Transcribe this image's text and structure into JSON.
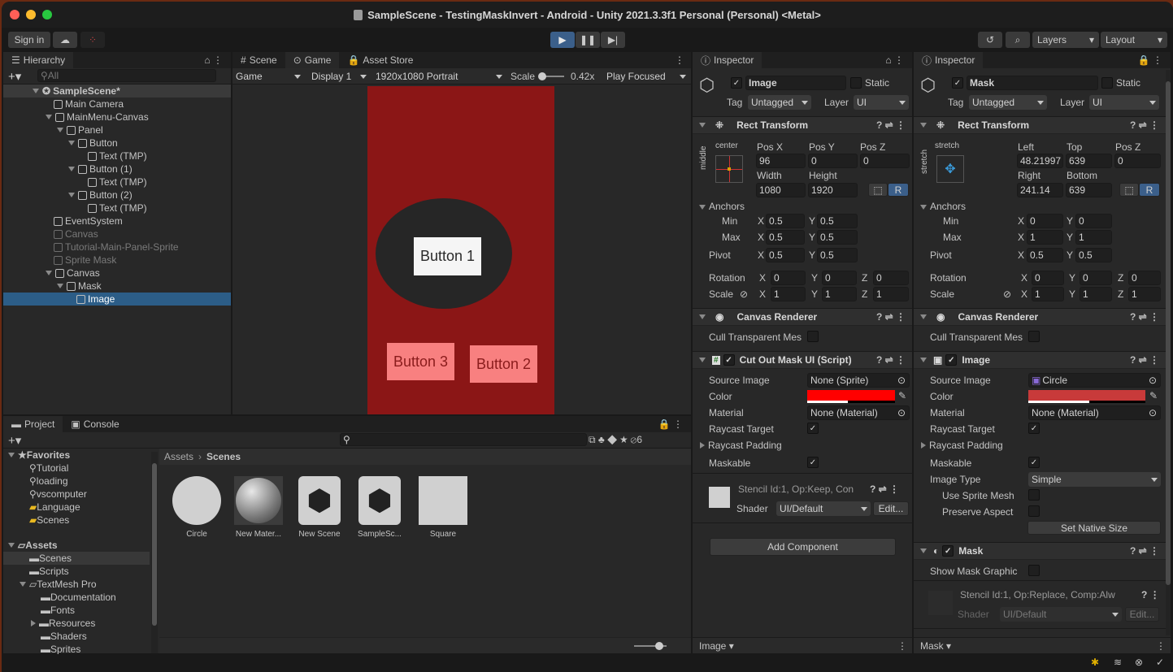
{
  "window": {
    "title": "SampleScene - TestingMaskInvert - Android - Unity 2021.3.3f1 Personal (Personal) <Metal>"
  },
  "toolbar": {
    "sign_in": "Sign in",
    "layers": "Layers",
    "layout": "Layout"
  },
  "hierarchy": {
    "tab": "Hierarchy",
    "search_placeholder": "All",
    "items": [
      {
        "label": "SampleScene*"
      },
      {
        "label": "Main Camera"
      },
      {
        "label": "MainMenu-Canvas"
      },
      {
        "label": "Panel"
      },
      {
        "label": "Button"
      },
      {
        "label": "Text (TMP)"
      },
      {
        "label": "Button (1)"
      },
      {
        "label": "Text (TMP)"
      },
      {
        "label": "Button (2)"
      },
      {
        "label": "Text (TMP)"
      },
      {
        "label": "EventSystem"
      },
      {
        "label": "Canvas"
      },
      {
        "label": "Tutorial-Main-Panel-Sprite"
      },
      {
        "label": "Sprite Mask"
      },
      {
        "label": "Canvas"
      },
      {
        "label": "Mask"
      },
      {
        "label": "Image"
      }
    ]
  },
  "game_view": {
    "tabs": [
      "Scene",
      "Game",
      "Asset Store"
    ],
    "mode": "Game",
    "display": "Display 1",
    "resolution": "1920x1080 Portrait",
    "scale_label": "Scale",
    "scale_value": "0.42x",
    "play_mode": "Play Focused",
    "buttons": [
      "Button 1",
      "Button 3",
      "Button 2"
    ],
    "colors": {
      "background": "#8b1616",
      "circle": "#262626",
      "button1": "#f5f5f5",
      "button_pink": "#f88080"
    }
  },
  "project": {
    "tabs": [
      "Project",
      "Console"
    ],
    "hidden_count": "6",
    "favorites_label": "Favorites",
    "favorites": [
      "Tutorial",
      "loading",
      "vscomputer",
      "Language",
      "Scenes"
    ],
    "assets_label": "Assets",
    "folders": [
      "Scenes",
      "Scripts",
      "TextMesh Pro",
      "Documentation",
      "Fonts",
      "Resources",
      "Shaders",
      "Sprites"
    ],
    "breadcrumb": [
      "Assets",
      "Scenes"
    ],
    "files": [
      "Circle",
      "New Mater...",
      "New Scene",
      "SampleSc...",
      "Square"
    ]
  },
  "inspector_left": {
    "tab": "Inspector",
    "name": "Image",
    "static": "Static",
    "tag_label": "Tag",
    "tag": "Untagged",
    "layer_label": "Layer",
    "layer": "UI",
    "rect": {
      "title": "Rect Transform",
      "anchor_h": "center",
      "anchor_v": "middle",
      "labels": [
        "Pos X",
        "Pos Y",
        "Pos Z",
        "Width",
        "Height"
      ],
      "values": [
        "96",
        "0",
        "0",
        "1080",
        "1920"
      ],
      "anchors": "Anchors",
      "min": "Min",
      "max": "Max",
      "pivot": "Pivot",
      "min_x": "0.5",
      "min_y": "0.5",
      "max_x": "0.5",
      "max_y": "0.5",
      "pivot_x": "0.5",
      "pivot_y": "0.5",
      "rotation": "Rotation",
      "scale": "Scale",
      "rot": [
        "0",
        "0",
        "0"
      ],
      "scl": [
        "1",
        "1",
        "1"
      ]
    },
    "canvas_renderer": {
      "title": "Canvas Renderer",
      "cull": "Cull Transparent Mes"
    },
    "script": {
      "title": "Cut Out Mask UI (Script)",
      "source_image": "Source Image",
      "source_value": "None (Sprite)",
      "color": "Color",
      "color_value": "#ff0000",
      "material": "Material",
      "material_value": "None (Material)",
      "raycast": "Raycast Target",
      "padding": "Raycast Padding",
      "maskable": "Maskable"
    },
    "material_preview": {
      "stencil": "Stencil Id:1, Op:Keep, Con",
      "shader": "Shader",
      "shader_value": "UI/Default",
      "edit": "Edit..."
    },
    "add_component": "Add Component",
    "footer": "Image"
  },
  "inspector_right": {
    "tab": "Inspector",
    "name": "Mask",
    "static": "Static",
    "tag_label": "Tag",
    "tag": "Untagged",
    "layer_label": "Layer",
    "layer": "UI",
    "rect": {
      "title": "Rect Transform",
      "anchor_h": "stretch",
      "anchor_v": "stretch",
      "labels": [
        "Left",
        "Top",
        "Pos Z",
        "Right",
        "Bottom"
      ],
      "values": [
        "48.21997",
        "639",
        "0",
        "241.14",
        "639"
      ],
      "anchors": "Anchors",
      "min": "Min",
      "max": "Max",
      "pivot": "Pivot",
      "min_x": "0",
      "min_y": "0",
      "max_x": "1",
      "max_y": "1",
      "pivot_x": "0.5",
      "pivot_y": "0.5",
      "rotation": "Rotation",
      "scale": "Scale",
      "rot": [
        "0",
        "0",
        "0"
      ],
      "scl": [
        "1",
        "1",
        "1"
      ]
    },
    "canvas_renderer": {
      "title": "Canvas Renderer",
      "cull": "Cull Transparent Mes"
    },
    "image": {
      "title": "Image",
      "source_image": "Source Image",
      "source_value": "Circle",
      "color": "Color",
      "color_value": "#c83a3a",
      "material": "Material",
      "material_value": "None (Material)",
      "raycast": "Raycast Target",
      "padding": "Raycast Padding",
      "maskable": "Maskable",
      "image_type": "Image Type",
      "image_type_value": "Simple",
      "sprite_mesh": "Use Sprite Mesh",
      "preserve": "Preserve Aspect",
      "native": "Set Native Size"
    },
    "mask": {
      "title": "Mask",
      "show": "Show Mask Graphic"
    },
    "material_preview": {
      "stencil": "Stencil Id:1, Op:Replace, Comp:Alw",
      "shader": "Shader",
      "shader_value": "UI/Default",
      "edit": "Edit..."
    },
    "footer": "Mask"
  }
}
